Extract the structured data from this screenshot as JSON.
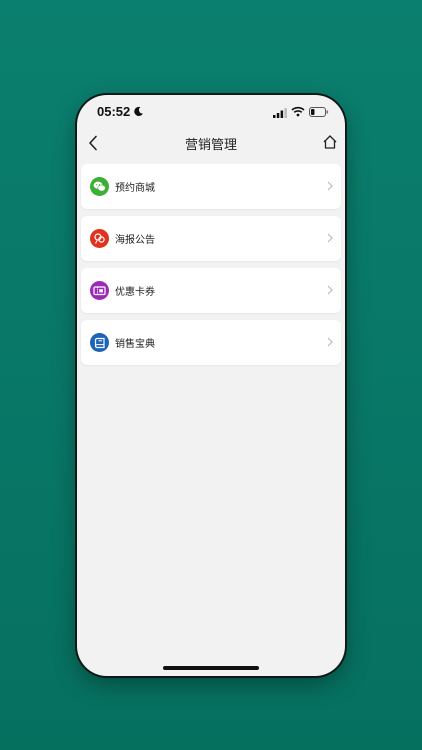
{
  "status": {
    "time": "05:52"
  },
  "header": {
    "title": "营销管理"
  },
  "menu": {
    "items": [
      {
        "label": "预约商城",
        "icon": "wechat-icon",
        "color": "#3cb034"
      },
      {
        "label": "海报公告",
        "icon": "poster-icon",
        "color": "#e0321d"
      },
      {
        "label": "优惠卡券",
        "icon": "coupon-icon",
        "color": "#9b2ab6"
      },
      {
        "label": "销售宝典",
        "icon": "book-icon",
        "color": "#1d63b8"
      }
    ]
  }
}
